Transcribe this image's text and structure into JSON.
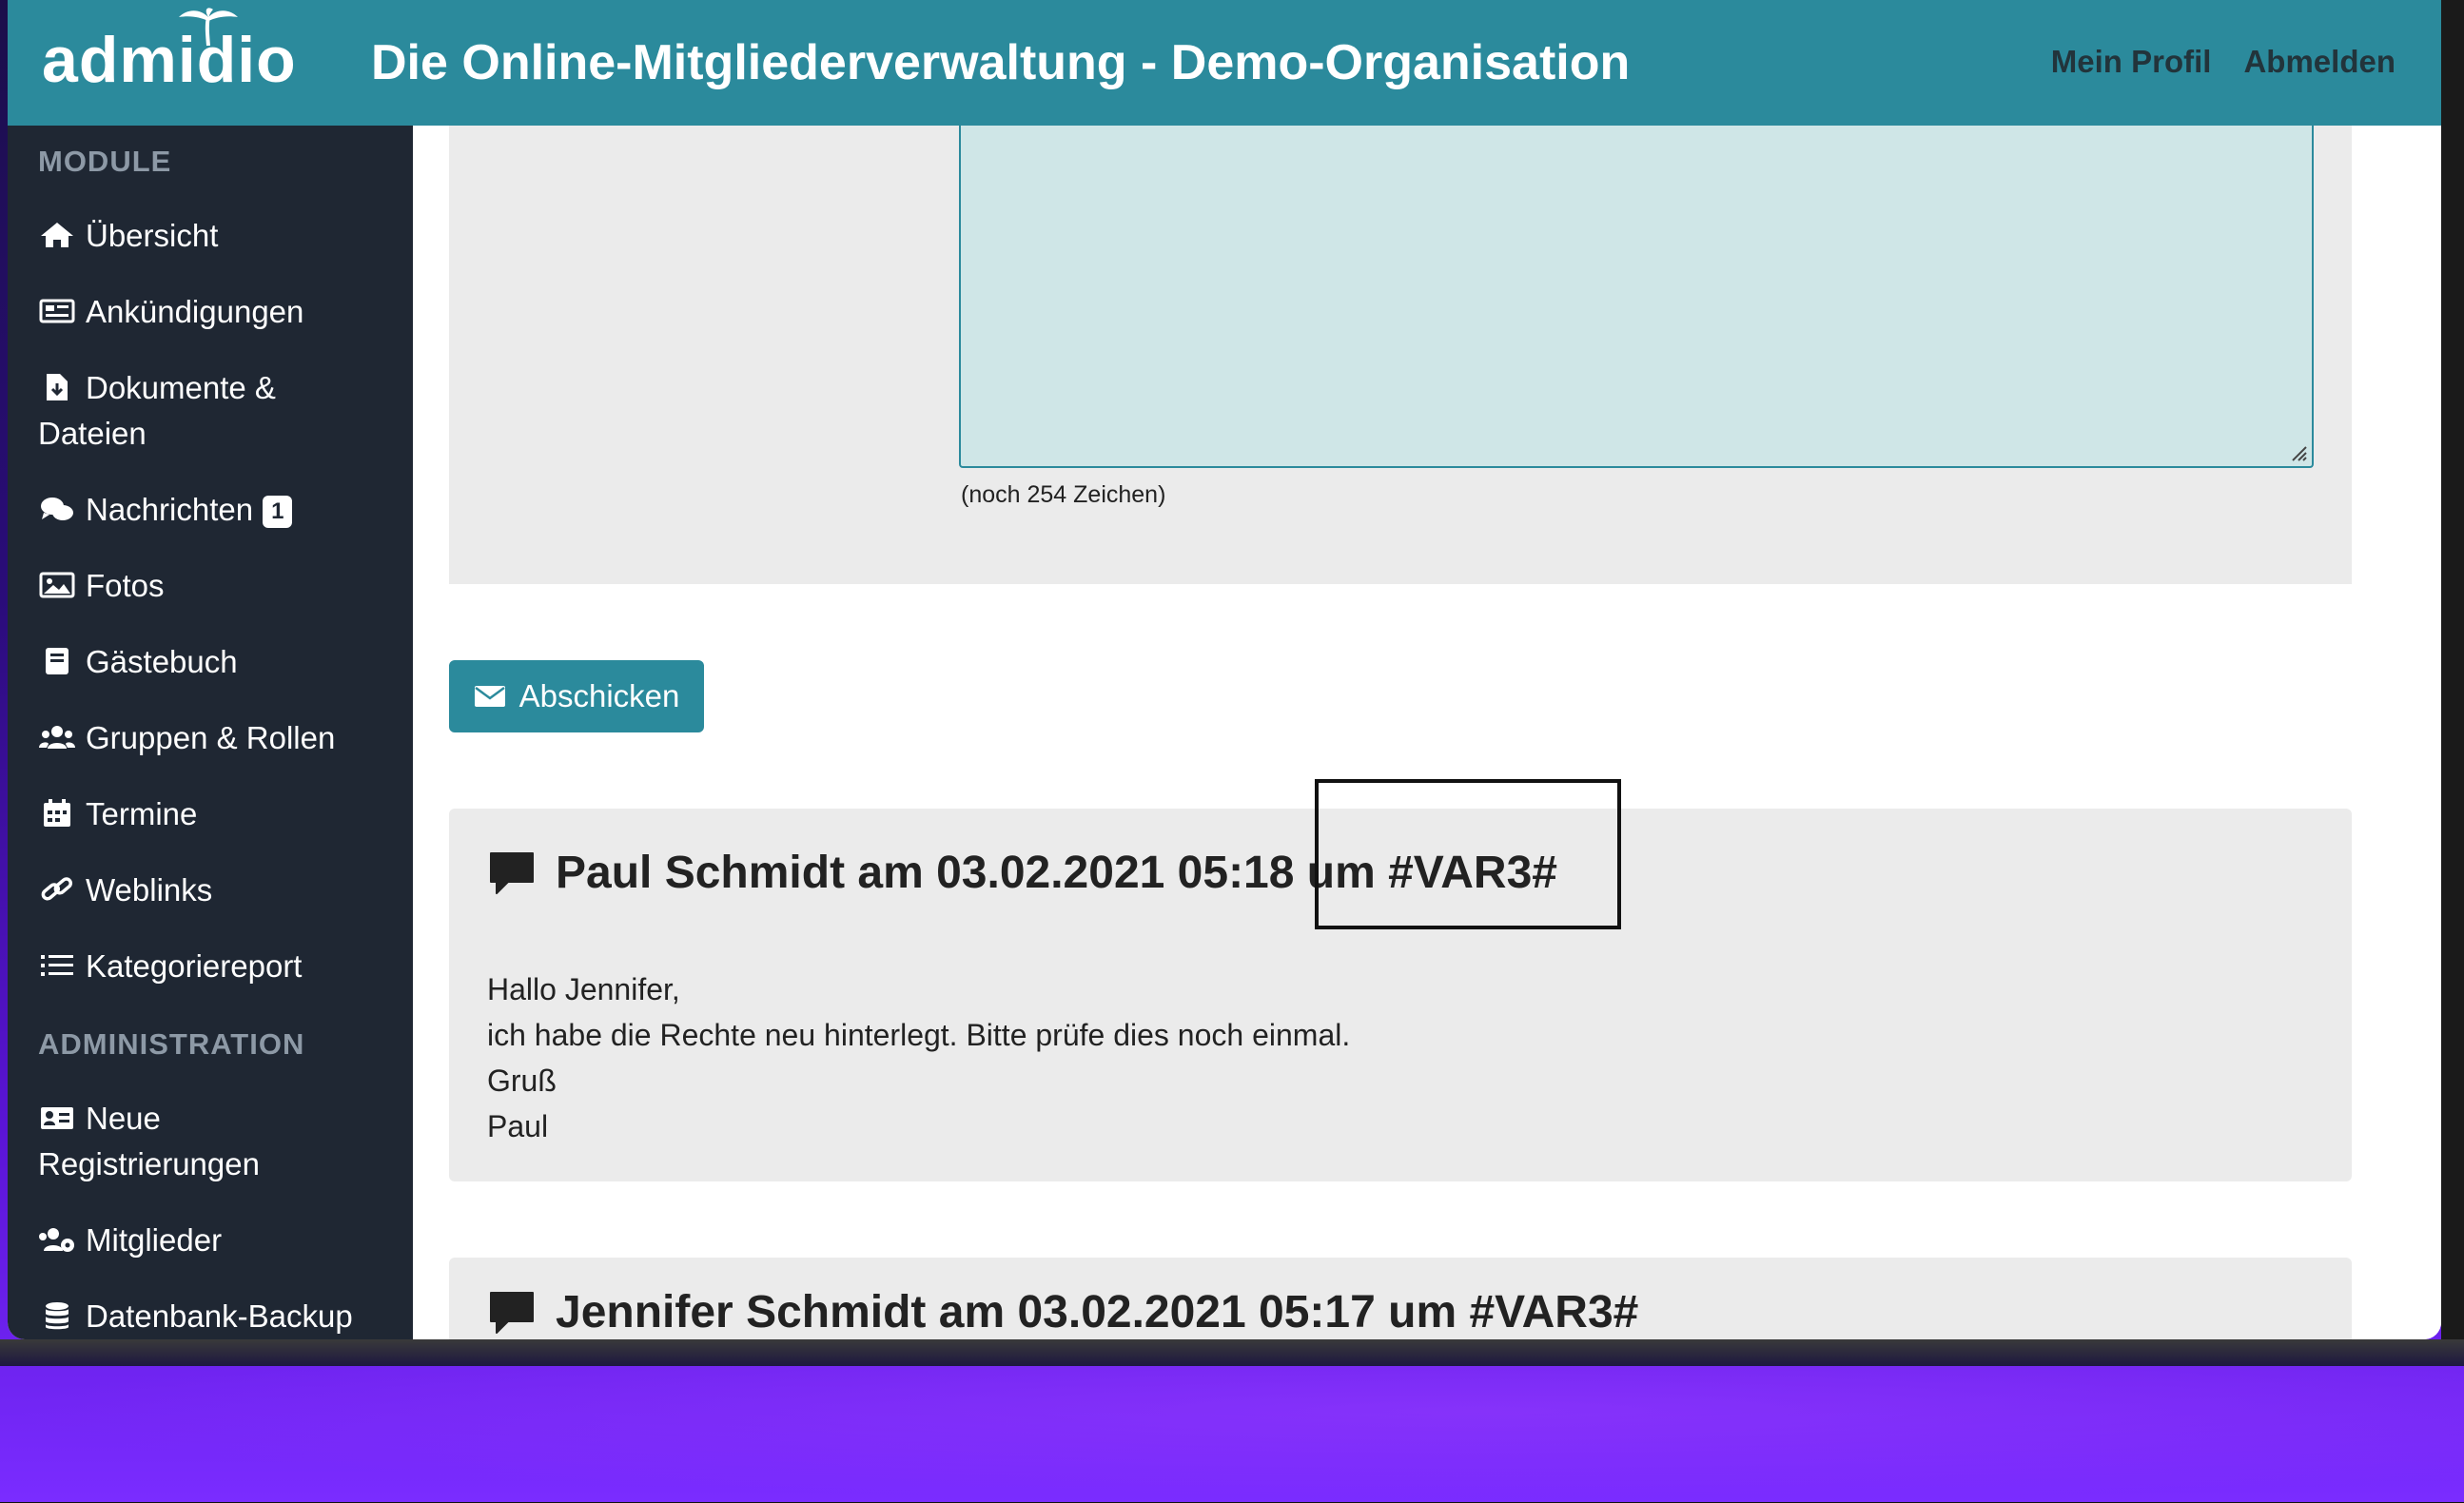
{
  "header": {
    "logo_text": "admidio",
    "title": "Die Online-Mitgliederverwaltung - Demo-Organisation",
    "nav": [
      "Mein Profil",
      "Abmelden"
    ]
  },
  "sidebar": {
    "section_module": "MODULE",
    "section_admin": "ADMINISTRATION",
    "items": [
      {
        "label": "Übersicht",
        "icon": "home-icon"
      },
      {
        "label": "Ankündigungen",
        "icon": "newspaper-icon"
      },
      {
        "label": "Dokumente &",
        "label2": "Dateien",
        "icon": "file-download-icon"
      },
      {
        "label": "Nachrichten",
        "badge": "1",
        "icon": "comments-icon"
      },
      {
        "label": "Fotos",
        "icon": "image-icon"
      },
      {
        "label": "Gästebuch",
        "icon": "book-icon"
      },
      {
        "label": "Gruppen & Rollen",
        "icon": "users-icon"
      },
      {
        "label": "Termine",
        "icon": "calendar-icon"
      },
      {
        "label": "Weblinks",
        "icon": "link-icon"
      },
      {
        "label": "Kategoriereport",
        "icon": "list-icon"
      }
    ],
    "admin_items": [
      {
        "label": "Neue",
        "label2": "Registrierungen",
        "icon": "id-card-icon"
      },
      {
        "label": "Mitglieder",
        "icon": "users-cog-icon"
      },
      {
        "label": "Datenbank-Backup",
        "icon": "database-icon"
      }
    ]
  },
  "form": {
    "char_count": "(noch 254 Zeichen)",
    "send_label": "Abschicken"
  },
  "messages": [
    {
      "title": "Paul Schmidt am 03.02.2021 05:18 um #VAR3#",
      "lines": [
        "Hallo Jennifer,",
        "ich habe die Rechte neu hinterlegt. Bitte prüfe dies noch einmal.",
        "Gruß",
        "Paul"
      ]
    },
    {
      "title": "Jennifer Schmidt am 03.02.2021 05:17 um #VAR3#"
    }
  ],
  "colors": {
    "brand": "#2b8a9c",
    "sidebar": "#1f2733",
    "panel": "#ebebeb",
    "textarea": "#cfe6e7"
  }
}
